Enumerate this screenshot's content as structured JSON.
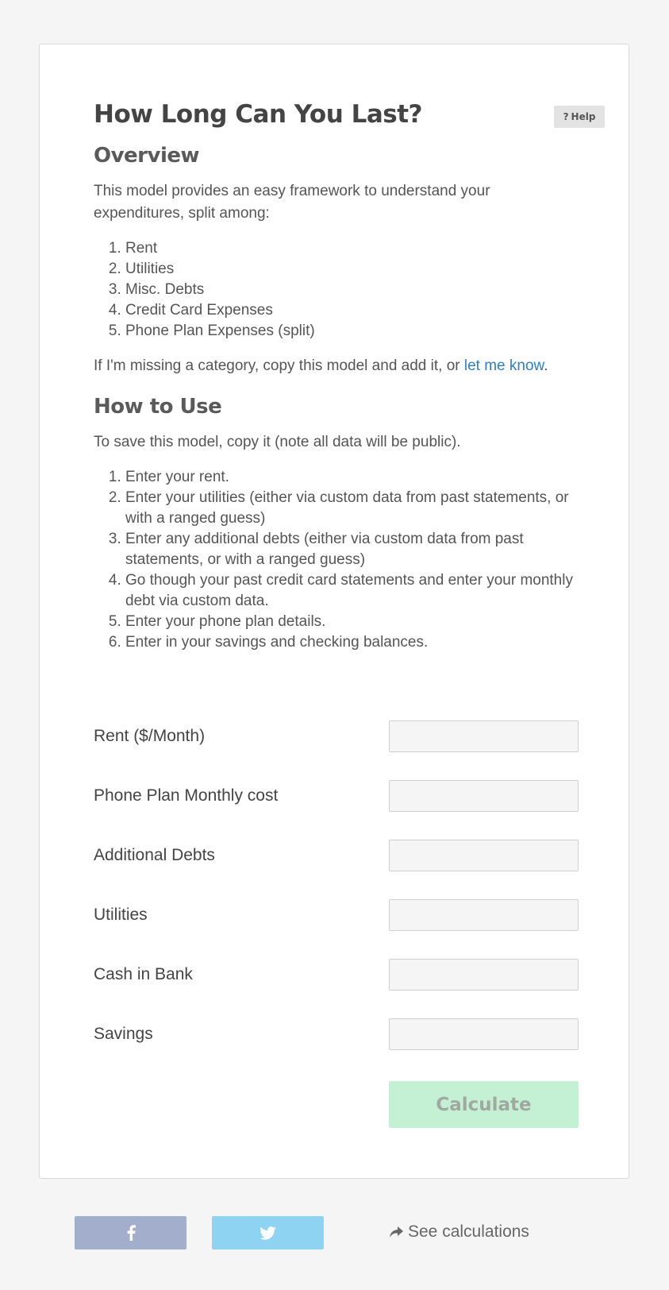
{
  "header": {
    "title": "How Long Can You Last?",
    "help_label": "Help"
  },
  "overview": {
    "heading": "Overview",
    "intro": "This model provides an easy framework to understand your expenditures, split among:",
    "items": [
      "Rent",
      "Utilities",
      "Misc. Debts",
      "Credit Card Expenses",
      "Phone Plan Expenses (split)"
    ],
    "missing_text": "If I'm missing a category, copy this model and add it, or ",
    "missing_link": "let me know",
    "missing_end": "."
  },
  "how_to_use": {
    "heading": "How to Use",
    "intro": "To save this model, copy it (note all data will be public).",
    "steps": [
      "Enter your rent.",
      "Enter your utilities (either via custom data from past statements, or with a ranged guess)",
      "Enter any additional debts (either via custom data from past statements, or with a ranged guess)",
      "Go though your past credit card statements and enter your monthly debt via custom data.",
      "Enter your phone plan details.",
      "Enter in your savings and checking balances."
    ]
  },
  "form": {
    "fields": [
      {
        "label": "Rent ($/Month)",
        "value": ""
      },
      {
        "label": "Phone Plan Monthly cost",
        "value": ""
      },
      {
        "label": "Additional Debts",
        "value": ""
      },
      {
        "label": "Utilities",
        "value": ""
      },
      {
        "label": "Cash in Bank",
        "value": ""
      },
      {
        "label": "Savings",
        "value": ""
      }
    ],
    "calculate_label": "Calculate"
  },
  "footer": {
    "facebook_icon": "facebook-icon",
    "twitter_icon": "twitter-icon",
    "see_calculations_label": "See calculations"
  },
  "colors": {
    "background": "#f6f5f5",
    "link": "#2f7fc6",
    "calculate_bg": "#c4f1d4",
    "facebook_bg": "#a2aecb",
    "twitter_bg": "#8ed4f2"
  }
}
